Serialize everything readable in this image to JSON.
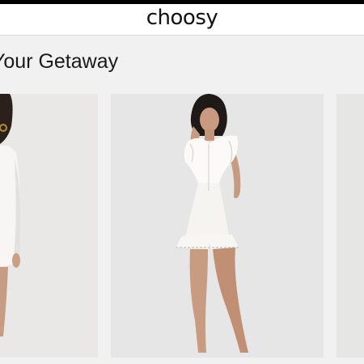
{
  "brand": {
    "logo_text": "choosy",
    "colors": {
      "background": "#f2f1f2",
      "header": "#ffffff",
      "top_bar": "#000000",
      "text": "#1a1a1a"
    }
  },
  "section": {
    "title": "Your Getaway"
  },
  "products": [
    {
      "position": "left",
      "image_icon": "model-in-white-romper-photo"
    },
    {
      "position": "center",
      "image_icon": "model-in-white-ruffle-playsuit-photo"
    },
    {
      "position": "right",
      "image_icon": "product-photo-partial"
    }
  ]
}
